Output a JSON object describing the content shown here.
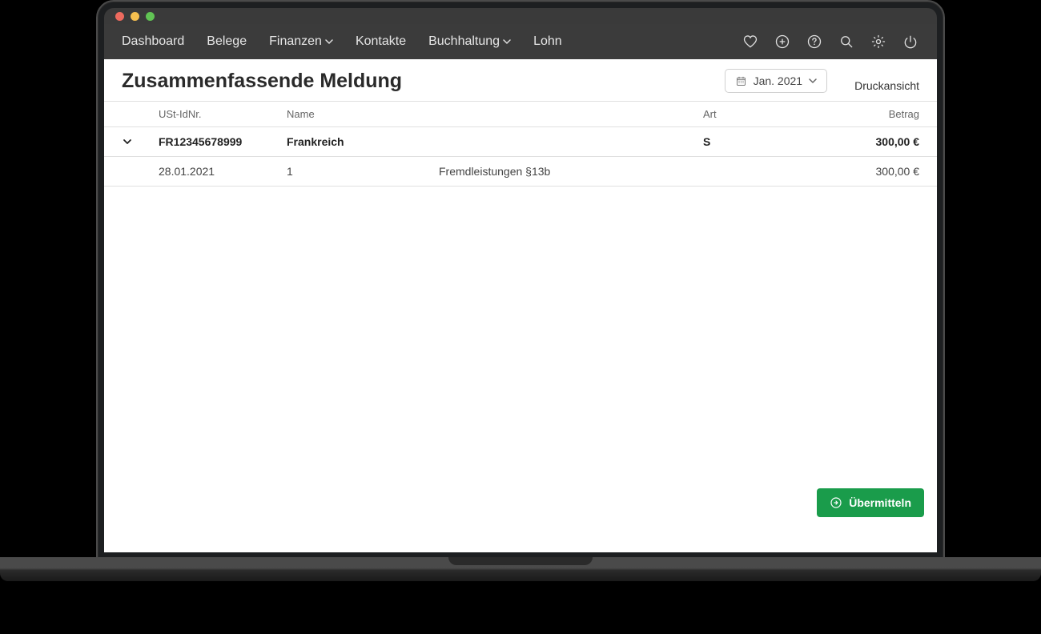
{
  "nav": {
    "dashboard": "Dashboard",
    "belege": "Belege",
    "finanzen": "Finanzen",
    "kontakte": "Kontakte",
    "buchhaltung": "Buchhaltung",
    "lohn": "Lohn"
  },
  "page": {
    "title": "Zusammenfassende Meldung",
    "date_label": "Jan. 2021",
    "print_link": "Druckansicht"
  },
  "table": {
    "headers": {
      "ustid": "USt-IdNr.",
      "name": "Name",
      "art": "Art",
      "betrag": "Betrag"
    },
    "summary": {
      "ustid": "FR12345678999",
      "name": "Frankreich",
      "art": "S",
      "betrag": "300,00 €"
    },
    "detail": {
      "date": "28.01.2021",
      "num": "1",
      "desc": "Fremdleistungen §13b",
      "betrag": "300,00 €"
    }
  },
  "submit_label": "Übermitteln"
}
